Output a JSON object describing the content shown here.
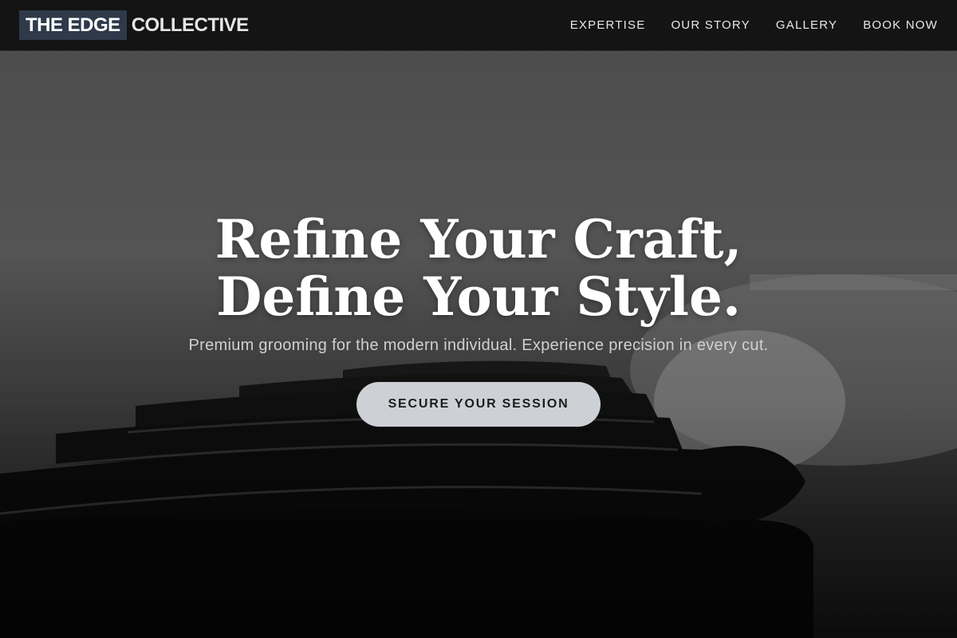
{
  "brand": {
    "boxed": "THE EDGE",
    "rest": "COLLECTIVE"
  },
  "nav": {
    "items": [
      {
        "label": "EXPERTISE"
      },
      {
        "label": "OUR STORY"
      },
      {
        "label": "GALLERY"
      },
      {
        "label": "BOOK NOW"
      }
    ]
  },
  "hero": {
    "title_line1": "Refine Your Craft,",
    "title_line2": "Define Your Style.",
    "subtitle": "Premium grooming for the modern individual. Experience precision in every cut.",
    "cta_label": "SECURE YOUR SESSION",
    "background": "photo-barbershop-chairs"
  },
  "colors": {
    "logo_box": "#2e3a4a",
    "cta_bg": "#cdd1d6",
    "nav_bg": "#141414"
  }
}
